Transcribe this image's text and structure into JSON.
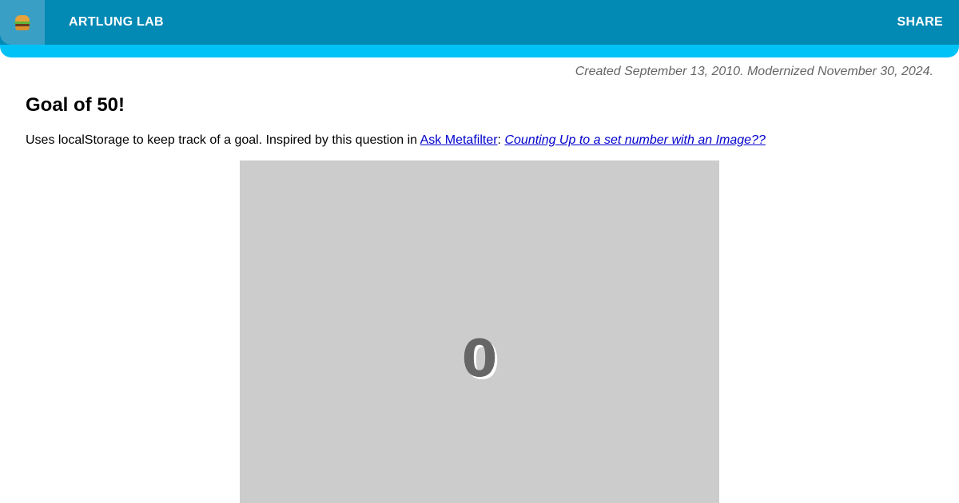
{
  "header": {
    "menu_icon": "hamburger-icon",
    "site_title": "ARTLUNG LAB",
    "share_label": "SHARE",
    "colors": {
      "bar": "#0289b4",
      "accent_strip": "#00c2f7",
      "menu_button": "#3a9fc4"
    }
  },
  "meta": {
    "dates": "Created September 13, 2010. Modernized November 30, 2024."
  },
  "main": {
    "title": "Goal of 50!",
    "intro_text": "Uses localStorage to keep track of a goal. Inspired by this question in ",
    "link_site_label": "Ask Metafilter",
    "separator": ": ",
    "link_question_label": "Counting Up to a set number with an Image??",
    "counter_value": "0",
    "goal_box_color": "#cccccc"
  }
}
